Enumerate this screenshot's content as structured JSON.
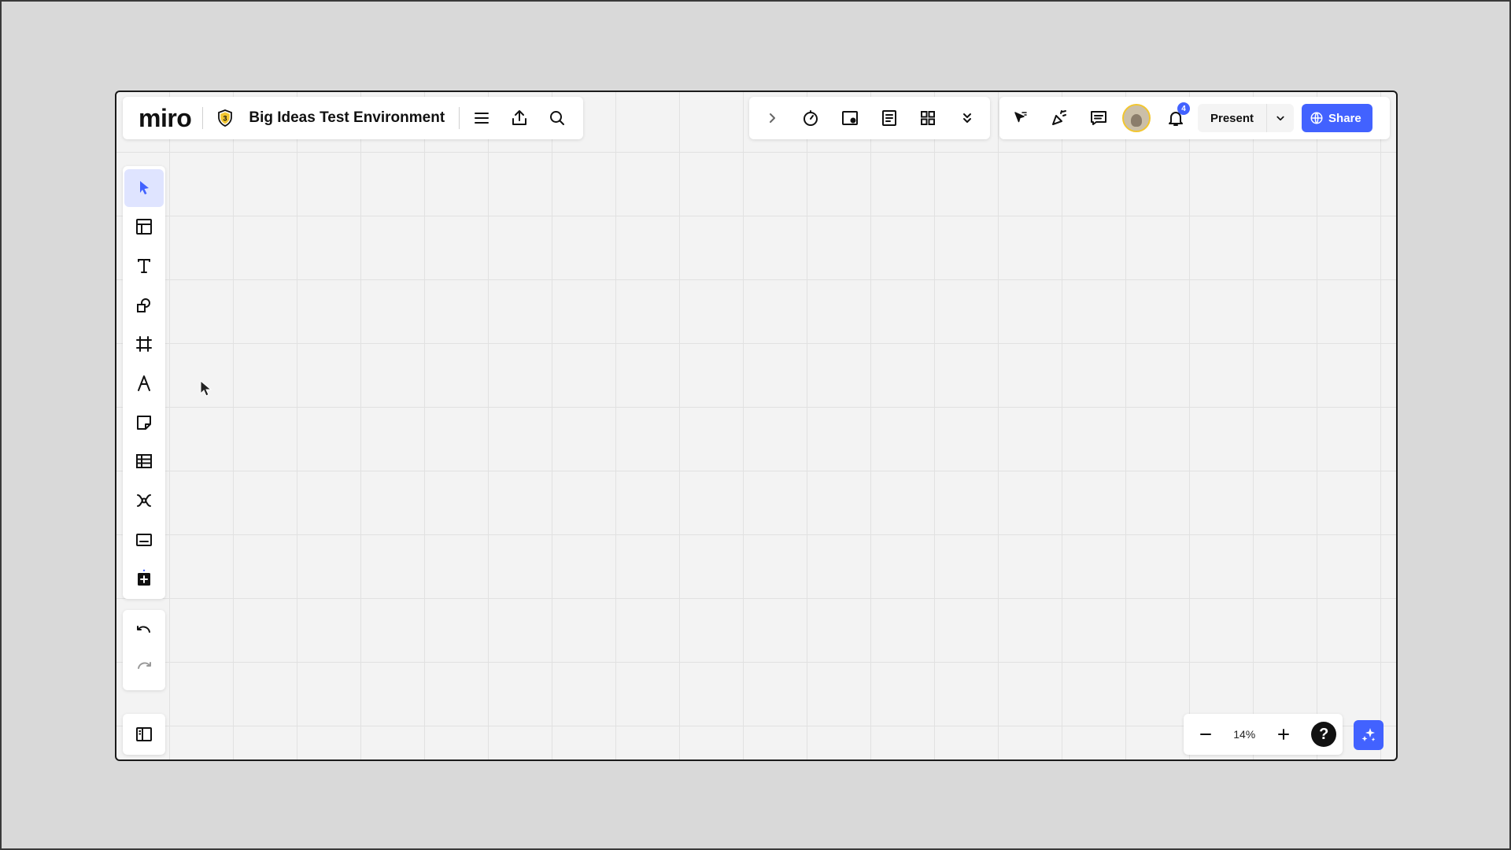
{
  "app": {
    "logo_text": "miro",
    "board_title": "Big Ideas Test Environment",
    "plan_badge": "3"
  },
  "top_center": {
    "icons": [
      "chevron-right-icon",
      "timer-icon",
      "card-icon",
      "notes-icon",
      "grid-icon",
      "double-chevron-down-icon"
    ]
  },
  "top_right": {
    "notification_count": "4",
    "present_label": "Present",
    "share_label": "Share"
  },
  "left_toolbar": {
    "tools": [
      "select",
      "templates",
      "text",
      "shapes",
      "frame",
      "pen",
      "sticky-note",
      "table",
      "mind-map",
      "embed",
      "add-more"
    ]
  },
  "zoom": {
    "level": "14%",
    "help_label": "?"
  },
  "colors": {
    "accent": "#4262ff",
    "active_tool_bg": "#dfe4ff",
    "canvas_bg": "#f3f3f3",
    "avatar_ring": "#f2c62f"
  }
}
